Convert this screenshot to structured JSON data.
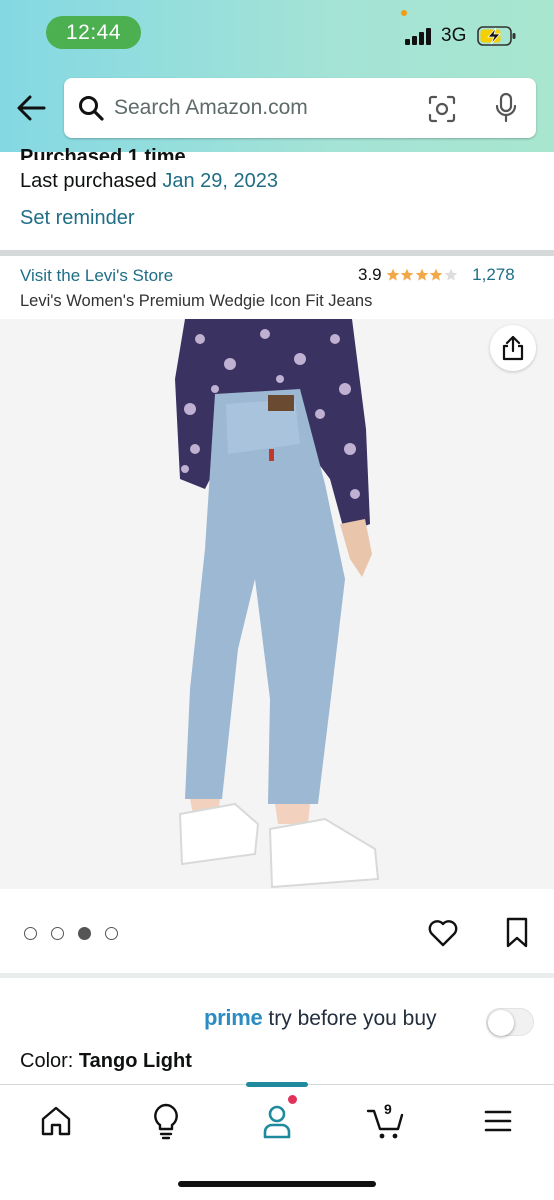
{
  "status_bar": {
    "time": "12:44",
    "network": "3G"
  },
  "search": {
    "placeholder": "Search Amazon.com"
  },
  "purchase_info": {
    "purchased_count": "Purchased 1 time",
    "last_purchased_label": "Last purchased",
    "last_purchased_date": "Jan 29, 2023",
    "set_reminder": "Set reminder"
  },
  "product": {
    "store_link": "Visit the Levi's Store",
    "rating": "3.9",
    "review_count": "1,278",
    "title": "Levi's Women's Premium Wedgie Icon Fit Jeans"
  },
  "carousel": {
    "dots": 4,
    "active_index": 2
  },
  "prime": {
    "brand": "prime",
    "label": "try before you buy"
  },
  "color": {
    "label": "Color:",
    "value": "Tango Light"
  },
  "bottom_nav": {
    "cart_count": "9",
    "items": [
      "home-icon",
      "lightbulb-icon",
      "account-icon",
      "cart-icon",
      "menu-icon"
    ]
  },
  "colors": {
    "link": "#1f6e86",
    "prime": "#2b8cc4",
    "star": "#f3a847",
    "active_tab": "#1f8a9d"
  }
}
